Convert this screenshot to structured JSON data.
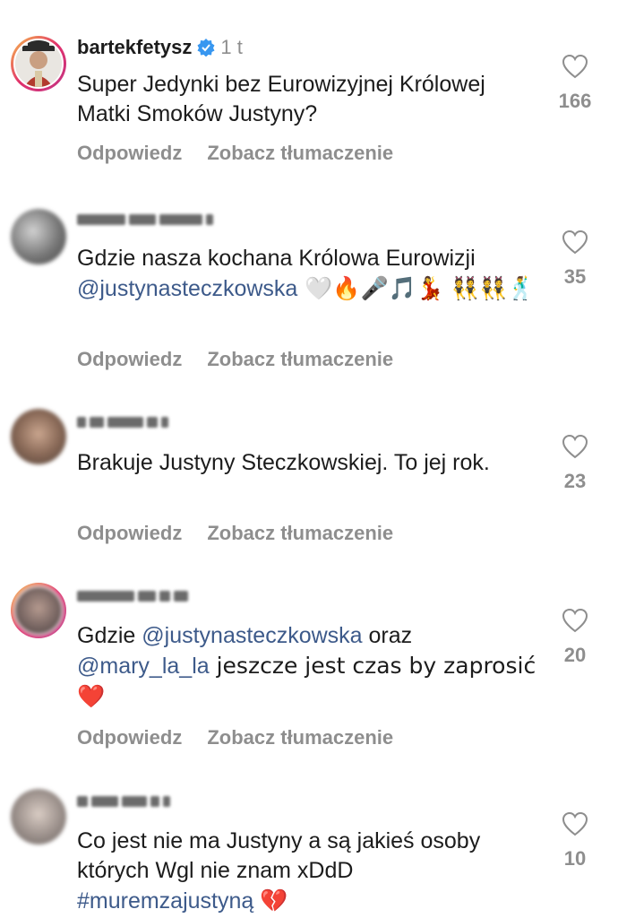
{
  "comments": [
    {
      "username": "bartekfetysz",
      "time": "1 t",
      "text": "Super Jedynki bez Eurowizyjnej Królowej Matki Smoków Justyny?",
      "likes": "166",
      "reply": "Odpowiedz",
      "translate": "Zobacz tłumaczenie"
    },
    {
      "text_before": "Gdzie nasza kochana Królowa Eurowizji ",
      "mention": "@justynasteczkowska",
      "text_after": " 🤍🔥🎤🎵💃 👯👯🕺",
      "likes": "35",
      "reply": "Odpowiedz",
      "translate": "Zobacz tłumaczenie"
    },
    {
      "text": "Brakuje Justyny Steczkowskiej. To jej rok.",
      "likes": "23",
      "reply": "Odpowiedz",
      "translate": "Zobacz tłumaczenie"
    },
    {
      "text_before": "Gdzie ",
      "mention1": "@justynasteczkowska",
      "text_middle": " oraz ",
      "mention2": "@mary_la_la",
      "text_after": " jeszcze jest czas by zaprosić ❤️",
      "likes": "20",
      "reply": "Odpowiedz",
      "translate": "Zobacz tłumaczenie"
    },
    {
      "text": "Co jest nie ma Justyny a są jakieś osoby których Wgl nie znam xDdD",
      "hashtag": "#muremzajustyną",
      "hashtag_emoji": "💔",
      "likes": "10"
    }
  ]
}
